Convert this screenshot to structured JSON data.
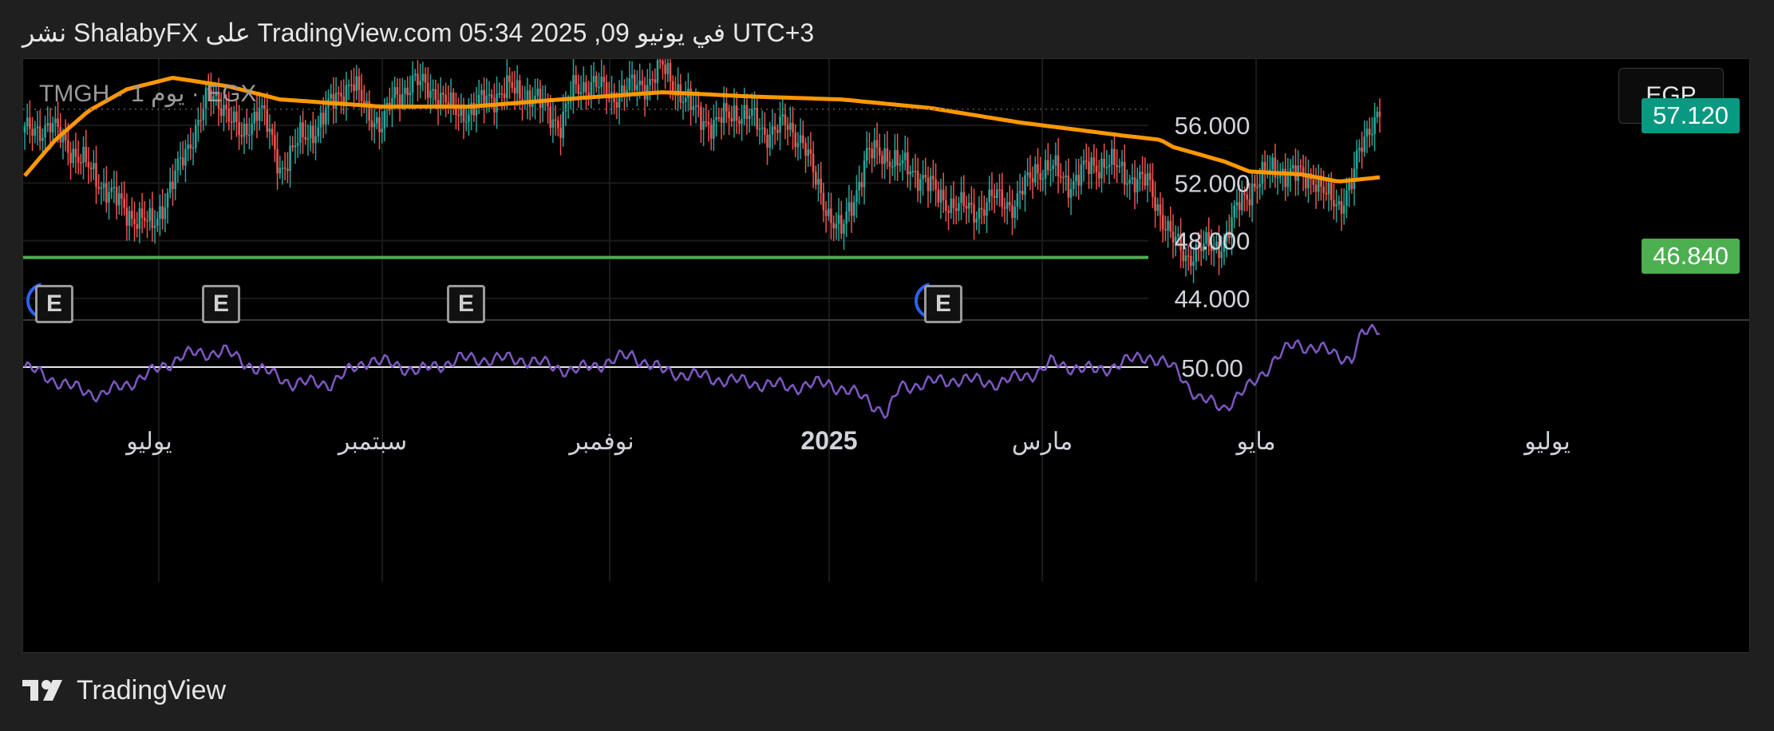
{
  "header": {
    "text": "نشر ShalabyFX على TradingView.com في يونيو 09, 2025 05:34 UTC+3"
  },
  "symbol": {
    "text": "TMGH · 1 يوم · EGX"
  },
  "currency": {
    "label": "EGP"
  },
  "price_labels": {
    "current": "57.120",
    "support": "46.840",
    "rsi_mid": "50.00"
  },
  "y_axis": {
    "ticks": [
      "56.000",
      "52.000",
      "48.000",
      "44.000"
    ],
    "tick_values": [
      56,
      52,
      48,
      44
    ]
  },
  "x_axis": {
    "ticks": [
      "يوليو",
      "سبتمبر",
      "نوفمبر",
      "2025",
      "مارس",
      "مايو",
      "يوليو"
    ]
  },
  "earnings_marker": {
    "label": "E"
  },
  "footer": {
    "brand": "TradingView"
  },
  "colors": {
    "up": "#26a69a",
    "down": "#ef5350",
    "ma": "#ff9800",
    "support": "#4caf50",
    "rsi": "#7e57c2",
    "price_tag": "#089981"
  },
  "chart_data": {
    "type": "candlestick",
    "symbol": "TMGH",
    "interval": "1D",
    "exchange": "EGX",
    "current_price": 57.12,
    "support_level": 46.84,
    "ylim": [
      42.5,
      60.6
    ],
    "rsi_level": 50,
    "x_ticks": [
      "يوليو",
      "سبتمبر",
      "نوفمبر",
      "2025",
      "مارس",
      "مايو",
      "يوليو"
    ],
    "series": [
      {
        "name": "price",
        "type": "candlestick",
        "anchors": [
          [
            0,
            55.5
          ],
          [
            10,
            56
          ],
          [
            20,
            54
          ],
          [
            30,
            52
          ],
          [
            40,
            50
          ],
          [
            50,
            49
          ],
          [
            58,
            52
          ],
          [
            65,
            55
          ],
          [
            72,
            58
          ],
          [
            78,
            57.5
          ],
          [
            85,
            55
          ],
          [
            92,
            57.5
          ],
          [
            100,
            53
          ],
          [
            108,
            55
          ],
          [
            115,
            56
          ],
          [
            122,
            58
          ],
          [
            128,
            59
          ],
          [
            134,
            57
          ],
          [
            140,
            56
          ],
          [
            145,
            58
          ],
          [
            152,
            59
          ],
          [
            160,
            58.5
          ],
          [
            168,
            57
          ],
          [
            175,
            57
          ],
          [
            182,
            58
          ],
          [
            190,
            58.5
          ],
          [
            198,
            58
          ],
          [
            205,
            57
          ],
          [
            210,
            56
          ],
          [
            215,
            58.5
          ],
          [
            222,
            59
          ],
          [
            230,
            58
          ],
          [
            236,
            58.5
          ],
          [
            244,
            59
          ],
          [
            250,
            60
          ],
          [
            256,
            58.5
          ],
          [
            262,
            57
          ],
          [
            270,
            56
          ],
          [
            278,
            57
          ],
          [
            285,
            56.5
          ],
          [
            290,
            55.5
          ],
          [
            298,
            56
          ],
          [
            305,
            55
          ],
          [
            310,
            52
          ],
          [
            315,
            50
          ],
          [
            320,
            48.5
          ],
          [
            325,
            51
          ],
          [
            330,
            54
          ],
          [
            338,
            54
          ],
          [
            345,
            53
          ],
          [
            352,
            52.5
          ],
          [
            358,
            51
          ],
          [
            365,
            50.5
          ],
          [
            372,
            50
          ],
          [
            380,
            51
          ],
          [
            388,
            50.5
          ],
          [
            396,
            53
          ],
          [
            402,
            53
          ],
          [
            410,
            52
          ],
          [
            416,
            53
          ],
          [
            424,
            53.5
          ],
          [
            432,
            52.5
          ],
          [
            440,
            52
          ],
          [
            445,
            50
          ],
          [
            450,
            48
          ],
          [
            455,
            46.84
          ],
          [
            460,
            47.5
          ],
          [
            466,
            47.5
          ],
          [
            470,
            48
          ],
          [
            476,
            50.5
          ],
          [
            482,
            52
          ],
          [
            490,
            53
          ],
          [
            498,
            52.5
          ],
          [
            505,
            52.5
          ],
          [
            510,
            51
          ],
          [
            515,
            50.5
          ],
          [
            520,
            52
          ],
          [
            523,
            54
          ],
          [
            527,
            56
          ],
          [
            531,
            57.12
          ]
        ]
      },
      {
        "name": "moving-average",
        "type": "line",
        "anchors": [
          [
            0,
            52.5
          ],
          [
            12,
            55
          ],
          [
            25,
            57
          ],
          [
            40,
            58.5
          ],
          [
            58,
            59.3
          ],
          [
            80,
            58.7
          ],
          [
            100,
            57.8
          ],
          [
            140,
            57.3
          ],
          [
            175,
            57.3
          ],
          [
            210,
            57.8
          ],
          [
            250,
            58.3
          ],
          [
            285,
            58
          ],
          [
            320,
            57.8
          ],
          [
            355,
            57.2
          ],
          [
            390,
            56.2
          ],
          [
            430,
            55.3
          ],
          [
            445,
            55
          ],
          [
            450,
            54.5
          ],
          [
            470,
            53.5
          ],
          [
            480,
            52.8
          ],
          [
            500,
            52.6
          ],
          [
            515,
            52.1
          ],
          [
            531,
            52.4
          ]
        ]
      },
      {
        "name": "rsi",
        "type": "line",
        "anchors": [
          [
            0,
            50
          ],
          [
            18,
            45
          ],
          [
            30,
            43
          ],
          [
            48,
            48
          ],
          [
            62,
            53
          ],
          [
            78,
            54
          ],
          [
            90,
            50
          ],
          [
            105,
            46
          ],
          [
            120,
            46
          ],
          [
            135,
            52
          ],
          [
            155,
            49
          ],
          [
            170,
            52
          ],
          [
            195,
            52
          ],
          [
            215,
            49
          ],
          [
            238,
            53
          ],
          [
            250,
            49
          ],
          [
            272,
            47
          ],
          [
            300,
            45
          ],
          [
            315,
            46
          ],
          [
            330,
            42
          ],
          [
            338,
            38
          ],
          [
            343,
            45
          ],
          [
            365,
            47
          ],
          [
            382,
            46
          ],
          [
            398,
            49
          ],
          [
            402,
            51
          ],
          [
            420,
            49
          ],
          [
            440,
            53
          ],
          [
            452,
            49
          ],
          [
            460,
            42
          ],
          [
            470,
            40
          ],
          [
            480,
            45
          ],
          [
            490,
            52
          ],
          [
            498,
            56
          ],
          [
            510,
            54
          ],
          [
            520,
            52
          ],
          [
            524,
            58
          ],
          [
            531,
            60
          ]
        ]
      }
    ]
  }
}
